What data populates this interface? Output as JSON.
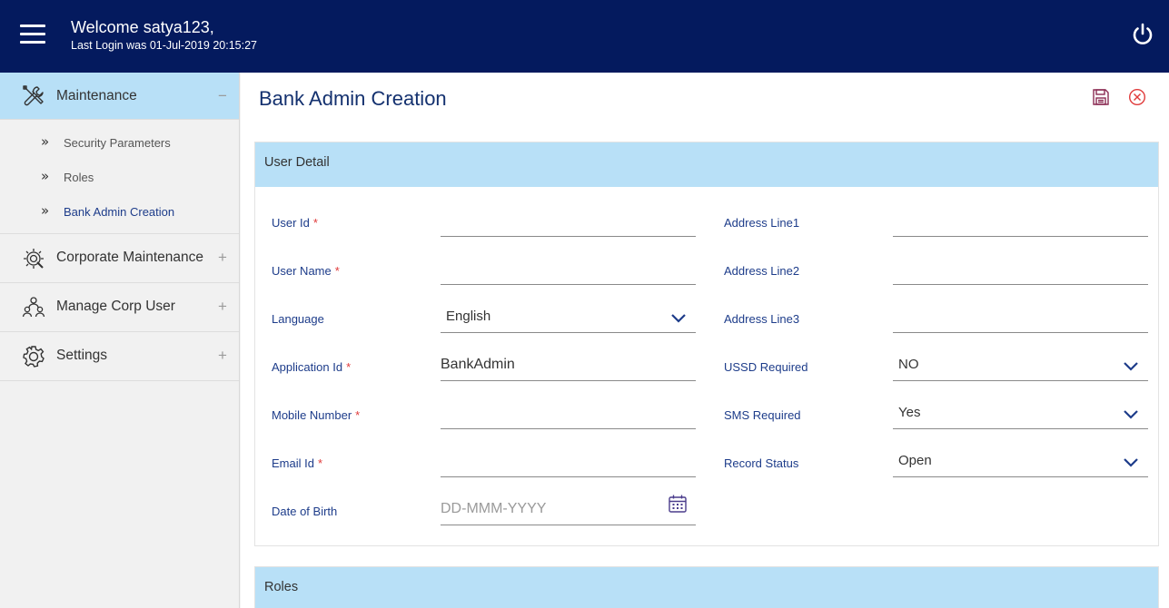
{
  "header": {
    "welcome": "Welcome satya123,",
    "last_login": "Last Login was 01-Jul-2019 20:15:27"
  },
  "sidebar": {
    "maintenance": {
      "label": "Maintenance",
      "toggle": "−",
      "items": [
        "Security Parameters",
        "Roles",
        "Bank Admin Creation"
      ]
    },
    "corporate_maintenance": {
      "label": "Corporate Maintenance",
      "toggle": "+"
    },
    "manage_corp_user": {
      "label": "Manage Corp User",
      "toggle": "+"
    },
    "settings": {
      "label": "Settings",
      "toggle": "+"
    }
  },
  "page": {
    "title": "Bank Admin Creation"
  },
  "user_detail": {
    "heading": "User Detail",
    "user_id": {
      "label": "User Id",
      "required": "*",
      "value": ""
    },
    "user_name": {
      "label": "User Name",
      "required": "*",
      "value": ""
    },
    "language": {
      "label": "Language",
      "value": "English"
    },
    "application_id": {
      "label": "Application Id",
      "required": "*",
      "value": "BankAdmin"
    },
    "mobile_number": {
      "label": "Mobile Number",
      "required": "*",
      "value": ""
    },
    "email_id": {
      "label": "Email Id",
      "required": "*",
      "value": ""
    },
    "date_of_birth": {
      "label": "Date of Birth",
      "placeholder": "DD-MMM-YYYY"
    },
    "address_line1": {
      "label": "Address Line1",
      "value": ""
    },
    "address_line2": {
      "label": "Address Line2",
      "value": ""
    },
    "address_line3": {
      "label": "Address Line3",
      "value": ""
    },
    "ussd_required": {
      "label": "USSD Required",
      "value": "NO"
    },
    "sms_required": {
      "label": "SMS Required",
      "value": "Yes"
    },
    "record_status": {
      "label": "Record Status",
      "value": "Open"
    }
  },
  "roles": {
    "heading": "Roles"
  },
  "colors": {
    "header_bg": "#041a5e",
    "accent_light": "#b8e0f7",
    "label_blue": "#1d3c8a",
    "required_red": "#e03a3a"
  }
}
